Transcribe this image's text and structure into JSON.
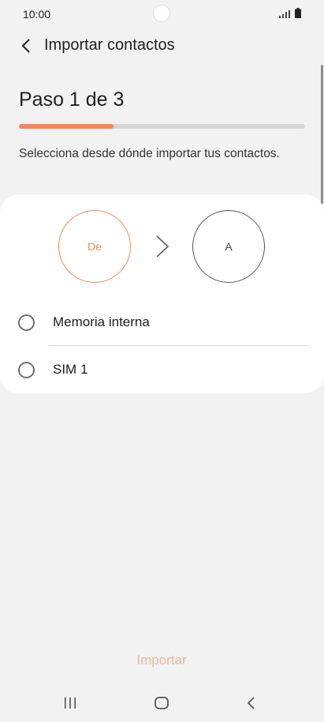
{
  "status_bar": {
    "time": "10:00"
  },
  "app_bar": {
    "title": "Importar contactos"
  },
  "step": {
    "title": "Paso 1 de 3",
    "progress": 0.33,
    "instruction": "Selecciona desde dónde importar tus contactos."
  },
  "transfer": {
    "from_label": "De",
    "to_label": "A"
  },
  "options": [
    {
      "label": "Memoria interna",
      "selected": false
    },
    {
      "label": "SIM 1",
      "selected": false
    }
  ],
  "footer": {
    "import_label": "Importar"
  },
  "colors": {
    "accent": "#eb8a62",
    "import_disabled": "#f0b59b"
  }
}
